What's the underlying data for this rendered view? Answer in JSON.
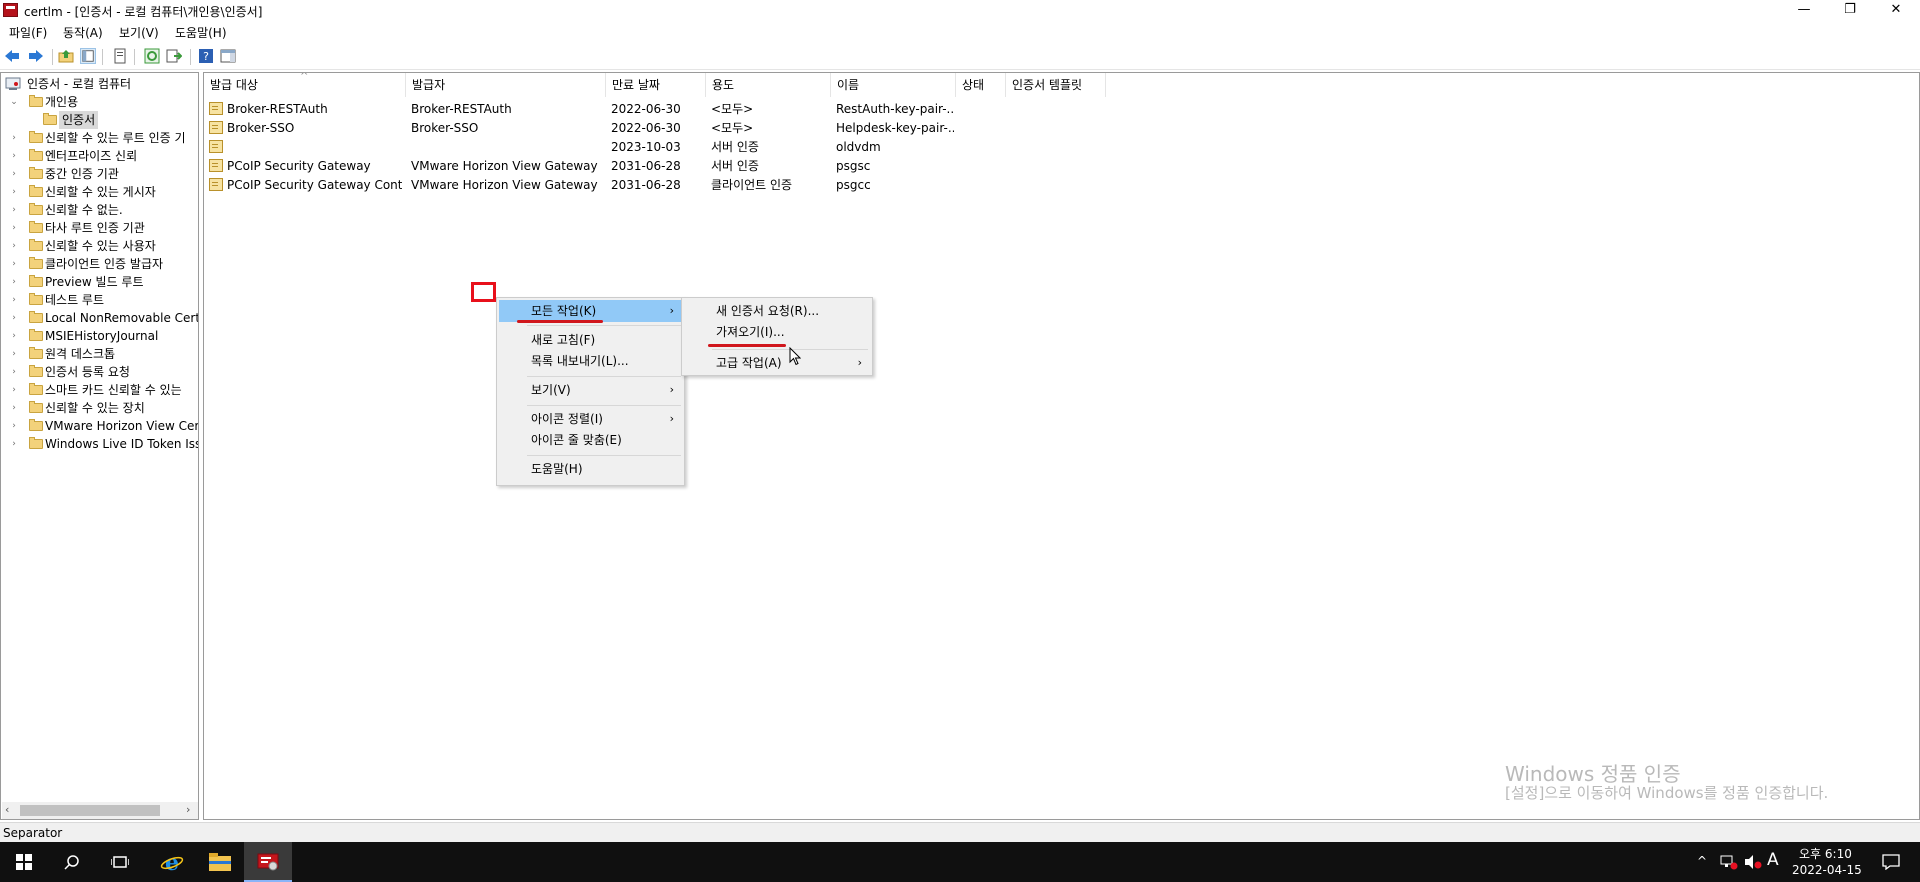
{
  "window": {
    "title": "certlm - [인증서 - 로컬 컴퓨터\\개인용\\인증서]",
    "minimize": "—",
    "restore": "❐",
    "close": "✕"
  },
  "menubar": [
    "파일(F)",
    "동작(A)",
    "보기(V)",
    "도움말(H)"
  ],
  "tree": {
    "root": "인증서 - 로컬 컴퓨터",
    "personal": "개인용",
    "certificates": "인증서",
    "items": [
      "신뢰할 수 있는 루트 인증 기",
      "엔터프라이즈 신뢰",
      "중간 인증 기관",
      "신뢰할 수 있는 게시자",
      "신뢰할 수 없는.",
      "타사 루트 인증 기관",
      "신뢰할 수 있는 사용자",
      "클라이언트 인증 발급자",
      "Preview 빌드 루트",
      "테스트 루트",
      "Local NonRemovable Certific",
      "MSIEHistoryJournal",
      "원격 데스크톱",
      "인증서 등록 요청",
      "스마트 카드 신뢰할 수 있는",
      "신뢰할 수 있는 장치",
      "VMware Horizon View Certif",
      "Windows Live ID Token Issue"
    ]
  },
  "list": {
    "columns": [
      "발급 대상",
      "발급자",
      "만료 날짜",
      "용도",
      "이름",
      "상태",
      "인증서 템플릿"
    ],
    "sort_indicator": "^",
    "rows": [
      [
        "Broker-RESTAuth",
        "Broker-RESTAuth",
        "2022-06-30",
        "<모두>",
        "RestAuth-key-pair-...",
        "",
        ""
      ],
      [
        "Broker-SSO",
        "Broker-SSO",
        "2022-06-30",
        "<모두>",
        "Helpdesk-key-pair-...",
        "",
        ""
      ],
      [
        "",
        "",
        "2023-10-03",
        "서버 인증",
        "oldvdm",
        "",
        ""
      ],
      [
        "PCoIP Security Gateway",
        "VMware Horizon View Gateway ...",
        "2031-06-28",
        "서버 인증",
        "psgsc",
        "",
        ""
      ],
      [
        "PCoIP Security Gateway Contr...",
        "VMware Horizon View Gateway ...",
        "2031-06-28",
        "클라이언트 인증",
        "psgcc",
        "",
        ""
      ]
    ]
  },
  "context_menu": {
    "items": [
      "모든 작업(K)",
      "새로 고침(F)",
      "목록 내보내기(L)...",
      "보기(V)",
      "아이콘 정렬(I)",
      "아이콘 줄 맞춤(E)",
      "도움말(H)"
    ]
  },
  "submenu": {
    "items": [
      "새 인증서 요청(R)...",
      "가져오기(I)...",
      "고급 작업(A)"
    ]
  },
  "watermark": {
    "line1": "Windows 정품 인증",
    "line2": "[설정]으로 이동하여 Windows를 정품 인증합니다."
  },
  "statusbar": {
    "text": "Separator"
  },
  "taskbar": {
    "time": "오후 6:10",
    "date": "2022-04-15",
    "ime": "A"
  },
  "colors": {
    "highlight": "#91c9f7",
    "annotation_red": "#e8101b",
    "taskbar": "#101010"
  }
}
